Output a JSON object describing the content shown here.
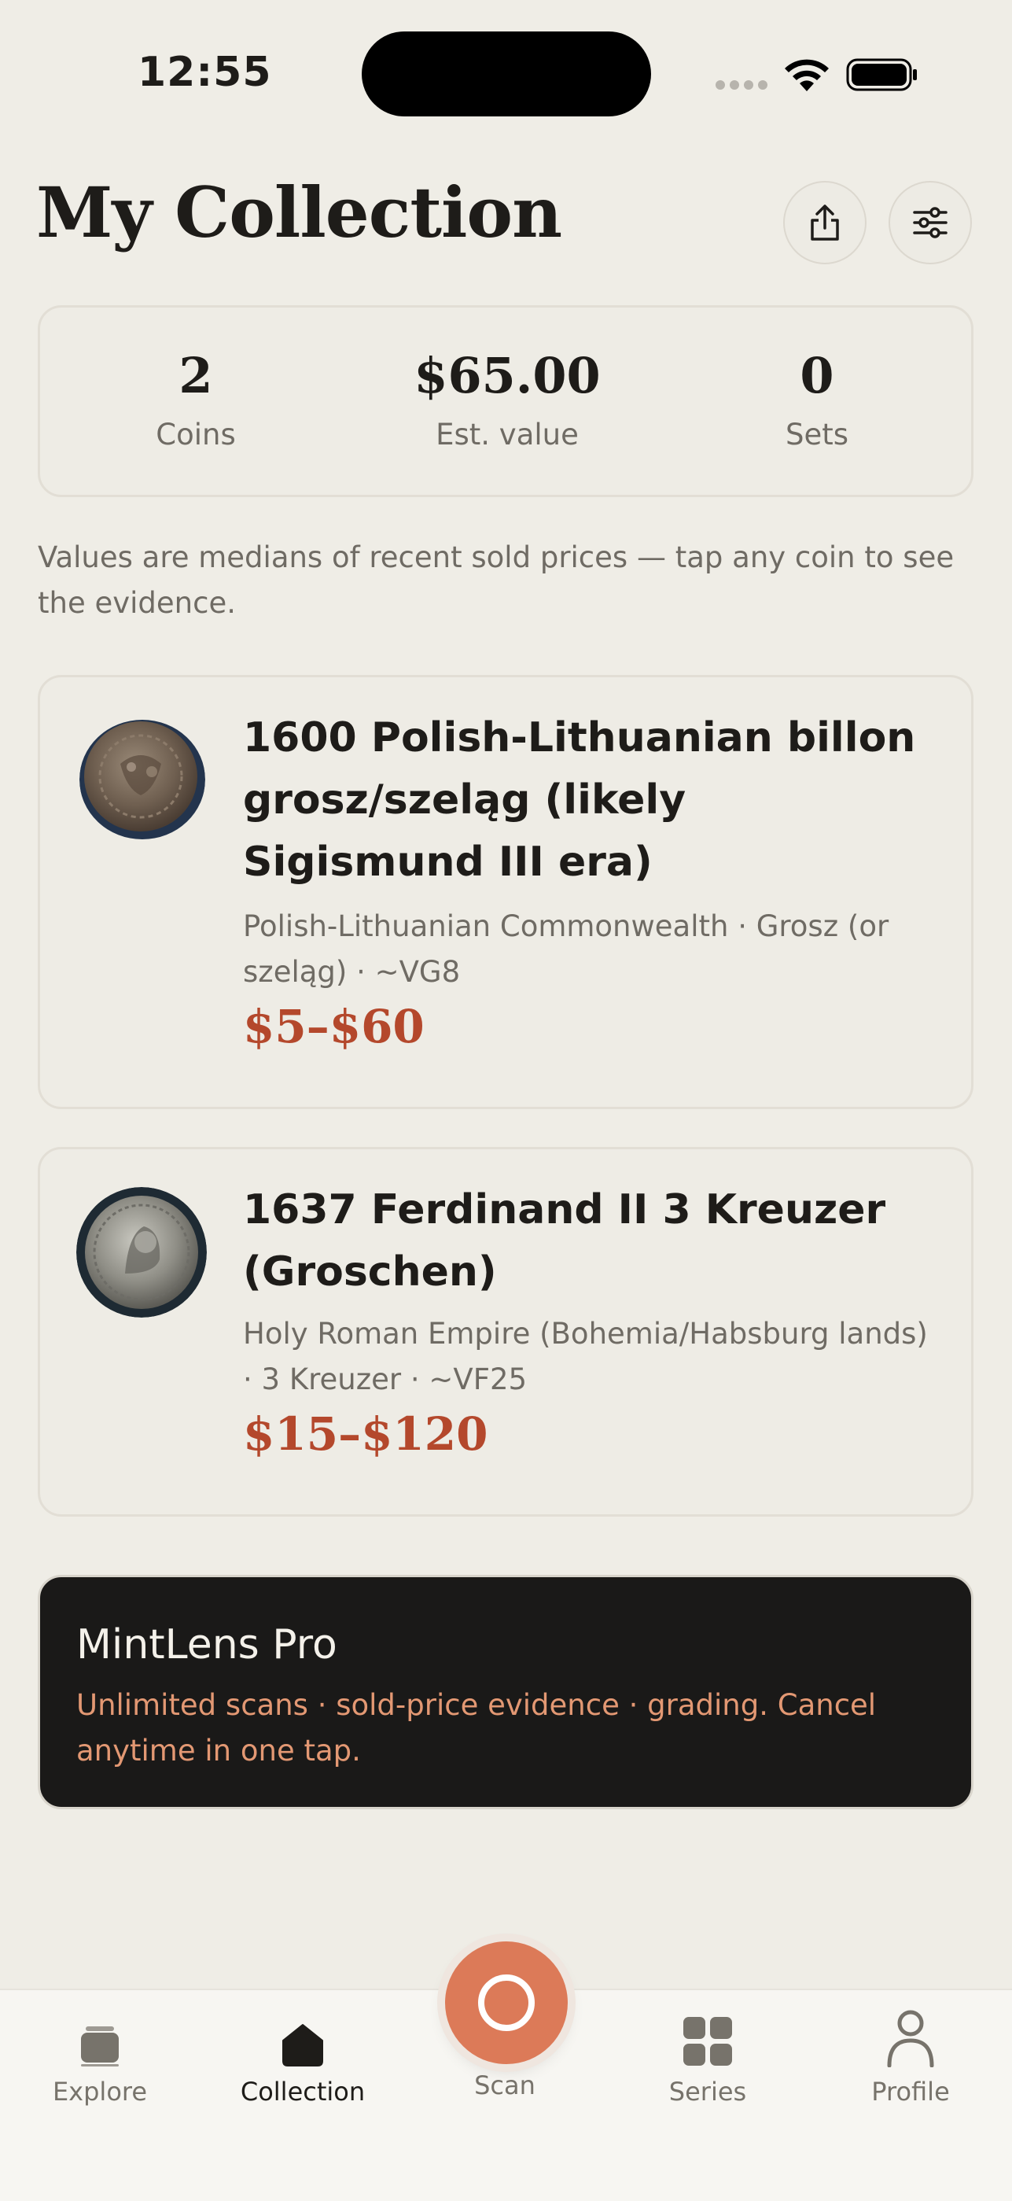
{
  "status_bar": {
    "time": "12:55"
  },
  "header": {
    "title": "My Collection"
  },
  "stats": [
    {
      "value": "2",
      "label": "Coins"
    },
    {
      "value": "$65.00",
      "label": "Est. value"
    },
    {
      "value": "0",
      "label": "Sets"
    }
  ],
  "note": "Values are medians of recent sold prices — tap any coin to see the evidence.",
  "coins": [
    {
      "title": "1600 Polish-Lithuanian billon grosz/szeląg (likely Sigismund III era)",
      "subtitle": "Polish-Lithuanian Commonwealth · Grosz (or szeląg) · ~VG8",
      "price": "$5–$60"
    },
    {
      "title": "1637 Ferdinand II 3 Kreuzer (Groschen)",
      "subtitle": "Holy Roman Empire (Bohemia/Habsburg lands) · 3 Kreuzer · ~VF25",
      "price": "$15–$120"
    }
  ],
  "pro_banner": {
    "title": "MintLens Pro",
    "subtitle": "Unlimited scans · sold-price evidence · grading. Cancel anytime in one tap."
  },
  "tabs": [
    {
      "label": "Explore",
      "icon": "stack-icon",
      "active": false
    },
    {
      "label": "Collection",
      "icon": "collection-icon",
      "active": true
    },
    {
      "label": "Scan",
      "icon": "scan-icon",
      "active": false
    },
    {
      "label": "Series",
      "icon": "grid-icon",
      "active": false
    },
    {
      "label": "Profile",
      "icon": "person-icon",
      "active": false
    }
  ],
  "colors": {
    "accent": "#dc7a58",
    "price": "#b4482c",
    "background": "#efede6",
    "banner": "#1a1918"
  }
}
